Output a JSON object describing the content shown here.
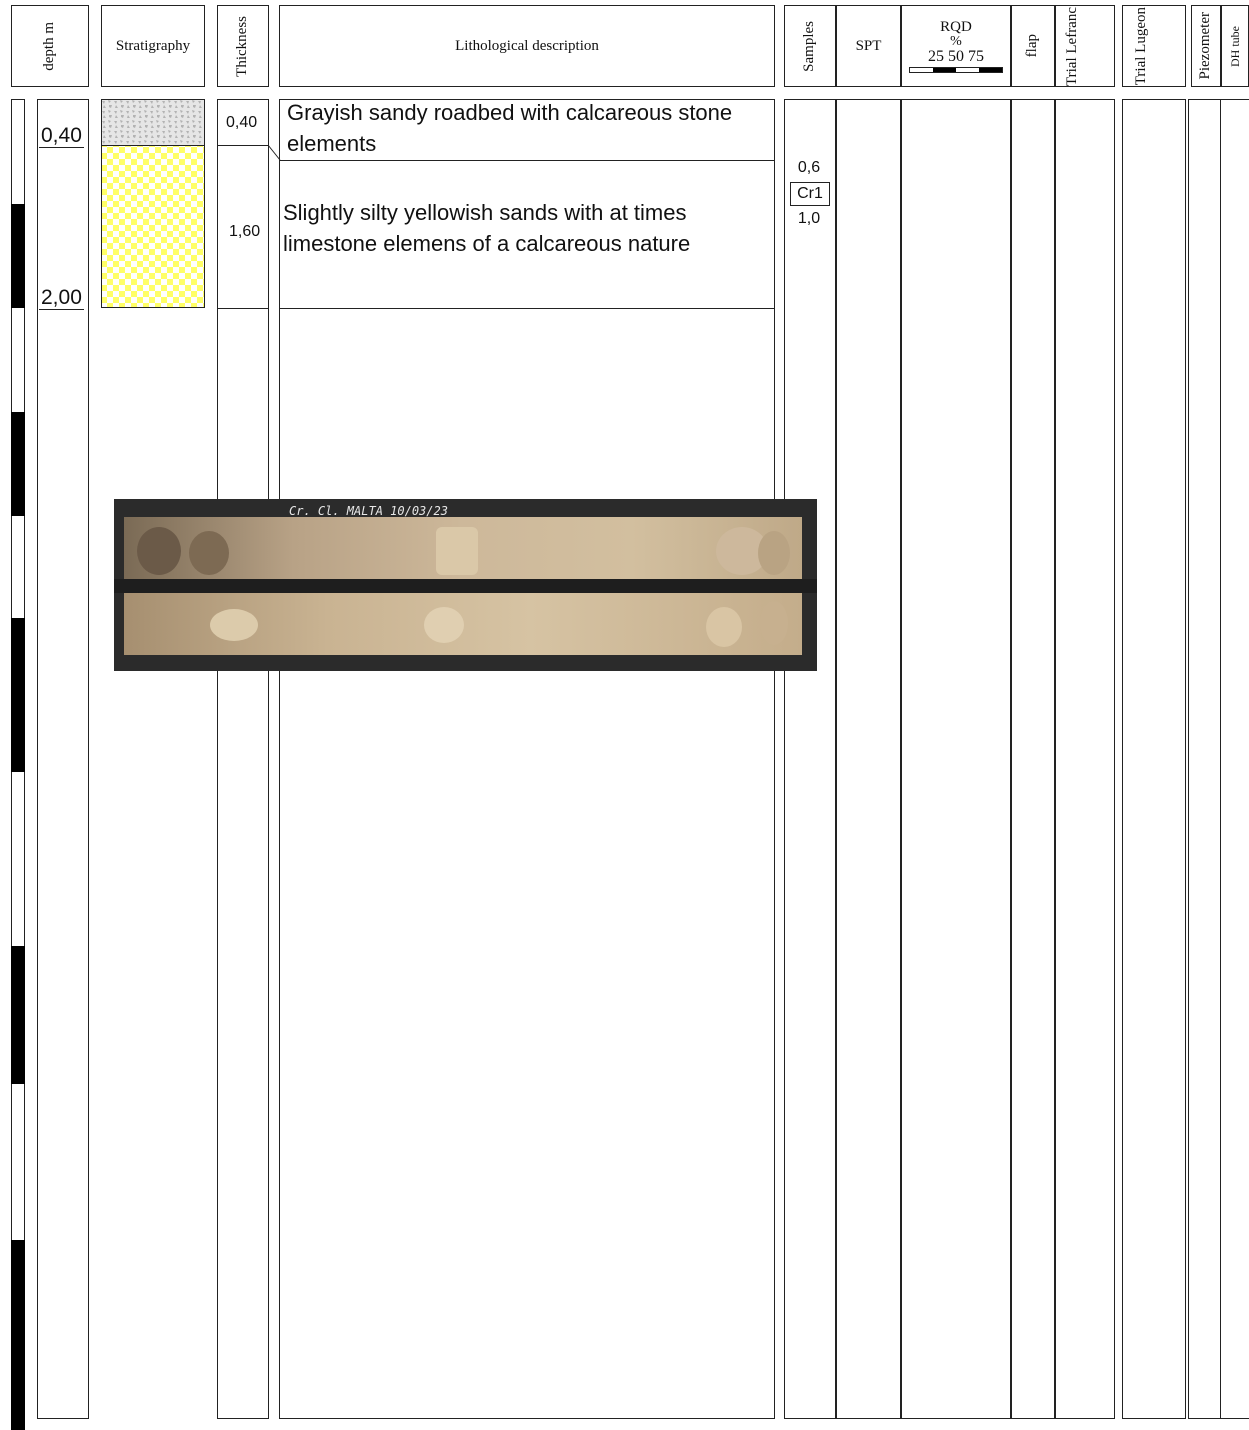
{
  "header": {
    "depth": "depth m",
    "stratigraphy": "Stratigraphy",
    "thickness": "Thickness",
    "lithology": "Lithological description",
    "samples": "Samples",
    "spt": "SPT",
    "rqd_title": "RQD",
    "rqd_unit": "%",
    "rqd_scale": "25 50 75",
    "flap": "flap",
    "trial_lefranc": "Trial Lefranc",
    "trial_lugeon": "Trial Lugeon",
    "piezometer": "Piezometer",
    "dh_tube": "DH tube"
  },
  "layers": [
    {
      "depth_bottom": "0,40",
      "thickness": "0,40",
      "description": "Grayish sandy roadbed with calcareous stone elements",
      "pattern": "gray-stone",
      "color": "#c8c8c8"
    },
    {
      "depth_bottom": "2,00",
      "thickness": "1,60",
      "description": "Slightly silty yellowish sands with at times limestone elemens of a calcareous nature",
      "pattern": "yellow-checker",
      "color": "#ffff66"
    }
  ],
  "sample": {
    "top": "0,6",
    "id": "Cr1",
    "bottom": "1,0"
  },
  "core_photo": {
    "label": "Cr. Cl. MALTA 10/03/23"
  },
  "colors": {
    "line": "#222222",
    "yellow": "#ffff66",
    "gray": "#c8c8c8",
    "core_box": "#262626"
  }
}
